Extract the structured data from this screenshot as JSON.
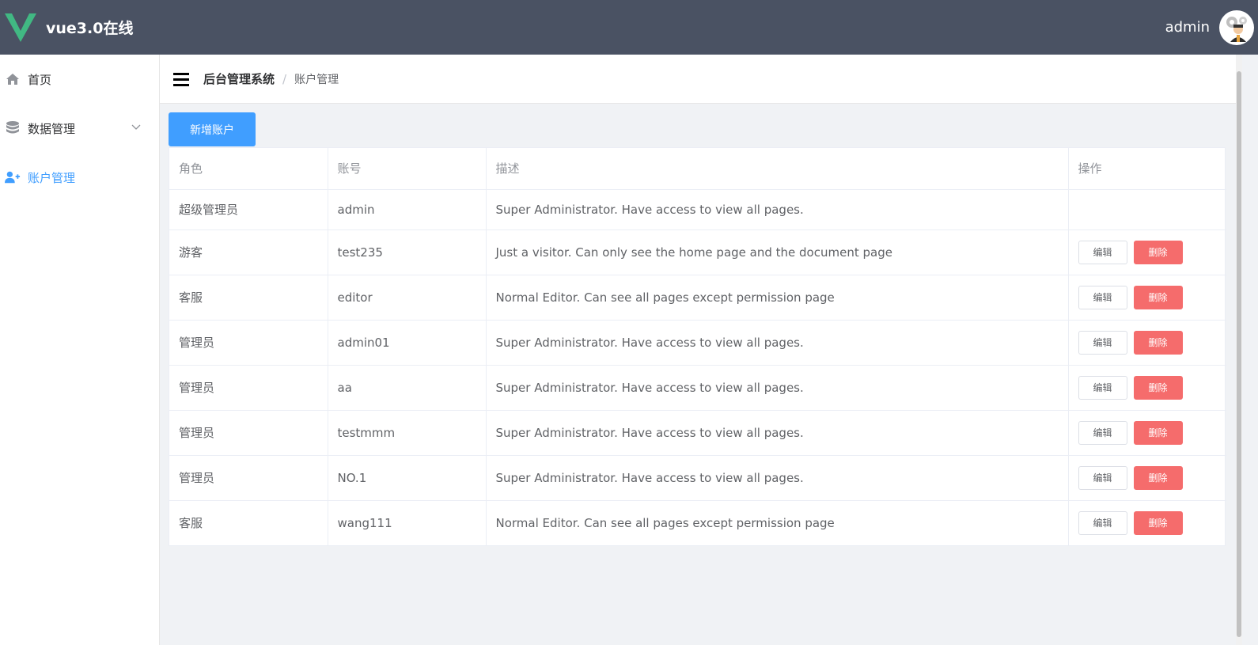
{
  "header": {
    "brand_title": "vue3.0在线",
    "username": "admin",
    "bg_color": "#4a5263",
    "logo_icon": "vue-logo-icon",
    "avatar_icon": "user-avatar"
  },
  "sidebar": {
    "items": [
      {
        "label": "首页",
        "icon": "home-icon",
        "active": false
      },
      {
        "label": "数据管理",
        "icon": "database-icon",
        "active": false,
        "has_submenu": true
      },
      {
        "label": "账户管理",
        "icon": "user-plus-icon",
        "active": true
      }
    ],
    "active_color": "#409eff"
  },
  "breadcrumb": {
    "root": "后台管理系统",
    "separator": "/",
    "current": "账户管理"
  },
  "toolbar": {
    "add_label": "新增账户"
  },
  "table": {
    "headers": [
      "角色",
      "账号",
      "描述",
      "操作"
    ],
    "edit_label": "编辑",
    "delete_label": "删除",
    "rows": [
      {
        "role": "超级管理员",
        "account": "admin",
        "desc": "Super Administrator. Have access to view all pages.",
        "actions": false
      },
      {
        "role": "游客",
        "account": "test235",
        "desc": "Just a visitor. Can only see the home page and the document page",
        "actions": true
      },
      {
        "role": "客服",
        "account": "editor",
        "desc": "Normal Editor. Can see all pages except permission page",
        "actions": true
      },
      {
        "role": "管理员",
        "account": "admin01",
        "desc": "Super Administrator. Have access to view all pages.",
        "actions": true
      },
      {
        "role": "管理员",
        "account": "aa",
        "desc": "Super Administrator. Have access to view all pages.",
        "actions": true
      },
      {
        "role": "管理员",
        "account": "testmmm",
        "desc": "Super Administrator. Have access to view all pages.",
        "actions": true
      },
      {
        "role": "管理员",
        "account": "NO.1",
        "desc": "Super Administrator. Have access to view all pages.",
        "actions": true
      },
      {
        "role": "客服",
        "account": "wang111",
        "desc": "Normal Editor. Can see all pages except permission page",
        "actions": true
      }
    ]
  }
}
